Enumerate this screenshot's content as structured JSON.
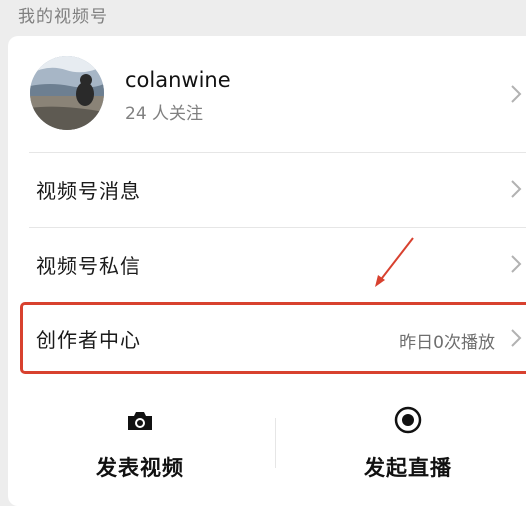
{
  "section_title": "我的视频号",
  "profile": {
    "username": "colanwine",
    "follow_count": "24 人关注"
  },
  "rows": [
    {
      "label": "视频号消息",
      "value": ""
    },
    {
      "label": "视频号私信",
      "value": ""
    },
    {
      "label": "创作者中心",
      "value": "昨日0次播放"
    }
  ],
  "actions": {
    "post_video": "发表视频",
    "start_live": "发起直播"
  },
  "colors": {
    "highlight": "#d8412f",
    "background": "#ededed"
  },
  "icons": [
    "camera-icon",
    "record-icon",
    "chevron-right-icon",
    "red-arrow-annotation"
  ]
}
